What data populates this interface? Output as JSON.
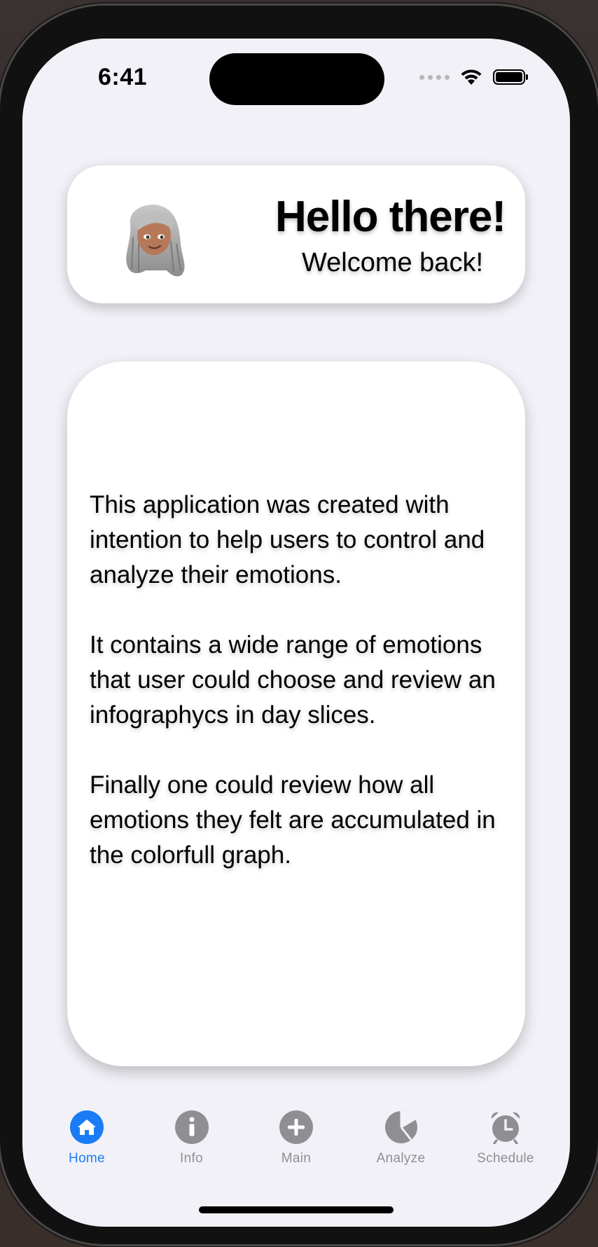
{
  "status_bar": {
    "time": "6:41",
    "icons": [
      "signal-dots-icon",
      "wifi-icon",
      "battery-icon"
    ]
  },
  "greeting": {
    "title": "Hello there!",
    "subtitle": "Welcome back!",
    "avatar": "memoji-avatar"
  },
  "info": {
    "paragraphs": [
      "This application was created with intention to help users to control and analyze their emotions.",
      " It contains a wide range of emotions that user could choose and review an infographycs in day slices.",
      " Finally one could review how all emotions they felt are accumulated in the colorfull graph."
    ]
  },
  "tabs": [
    {
      "label": "Home",
      "icon": "home-icon",
      "active": true
    },
    {
      "label": "Info",
      "icon": "info-icon",
      "active": false
    },
    {
      "label": "Main",
      "icon": "plus-circle-icon",
      "active": false
    },
    {
      "label": "Analyze",
      "icon": "pie-chart-icon",
      "active": false
    },
    {
      "label": "Schedule",
      "icon": "alarm-clock-icon",
      "active": false
    }
  ],
  "colors": {
    "accent": "#1a7cf5",
    "inactive": "#8e8e93",
    "background": "#f2f1f7",
    "card": "#ffffff"
  }
}
